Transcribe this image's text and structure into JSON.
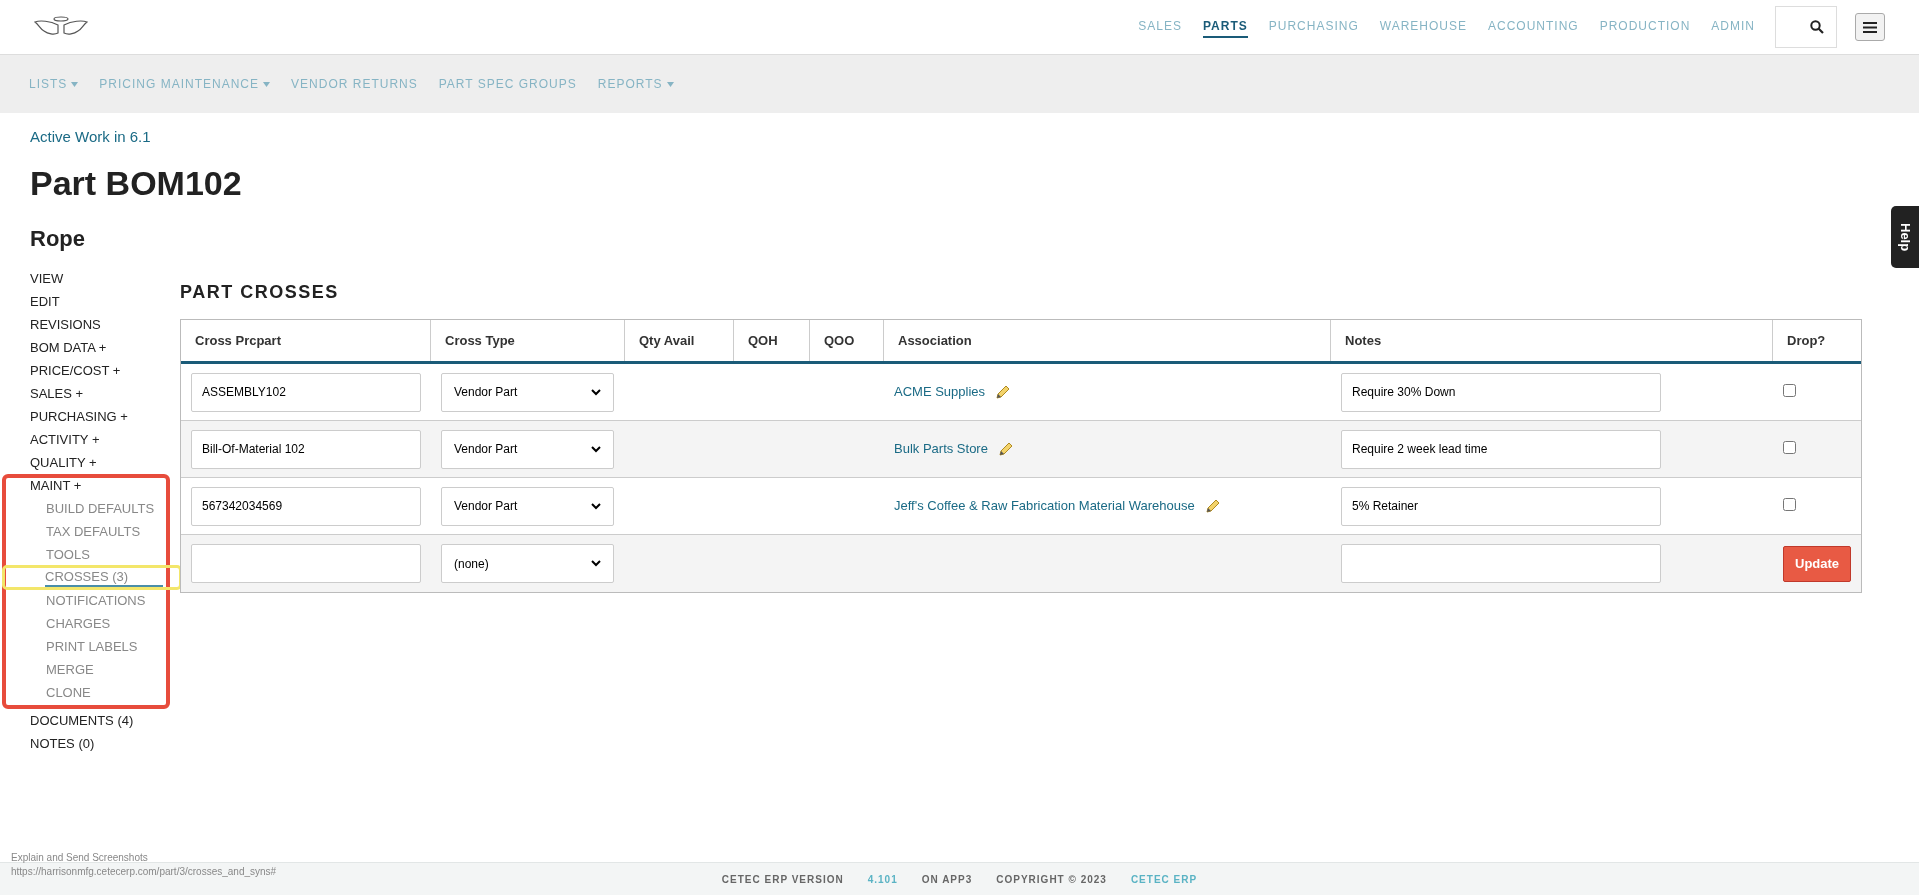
{
  "top_nav": [
    {
      "label": "SALES",
      "selected": false
    },
    {
      "label": "PARTS",
      "selected": true
    },
    {
      "label": "PURCHASING",
      "selected": false
    },
    {
      "label": "WAREHOUSE",
      "selected": false
    },
    {
      "label": "ACCOUNTING",
      "selected": false
    },
    {
      "label": "PRODUCTION",
      "selected": false
    },
    {
      "label": "ADMIN",
      "selected": false
    }
  ],
  "sub_nav": [
    {
      "label": "LISTS",
      "dropdown": true
    },
    {
      "label": "PRICING MAINTENANCE",
      "dropdown": true
    },
    {
      "label": "VENDOR RETURNS",
      "dropdown": false
    },
    {
      "label": "PART SPEC GROUPS",
      "dropdown": false
    },
    {
      "label": "REPORTS",
      "dropdown": true
    }
  ],
  "breadcrumb": "Active Work in 6.1",
  "title": "Part BOM102",
  "subtitle": "Rope",
  "sidebar": [
    {
      "label": "VIEW"
    },
    {
      "label": "EDIT"
    },
    {
      "label": "REVISIONS"
    },
    {
      "label": "BOM DATA +"
    },
    {
      "label": "PRICE/COST +"
    },
    {
      "label": "SALES +"
    },
    {
      "label": "PURCHASING +"
    },
    {
      "label": "ACTIVITY +"
    },
    {
      "label": "QUALITY +"
    },
    {
      "label": "MAINT +",
      "children": [
        {
          "label": "BUILD DEFAULTS",
          "selected": false
        },
        {
          "label": "TAX DEFAULTS",
          "selected": false
        },
        {
          "label": "TOOLS",
          "selected": false
        },
        {
          "label": "CROSSES (3)",
          "selected": true
        },
        {
          "label": "NOTIFICATIONS",
          "selected": false
        },
        {
          "label": "CHARGES",
          "selected": false
        },
        {
          "label": "PRINT LABELS",
          "selected": false
        },
        {
          "label": "MERGE",
          "selected": false
        },
        {
          "label": "CLONE",
          "selected": false
        }
      ]
    },
    {
      "label": "DOCUMENTS (4)"
    },
    {
      "label": "NOTES (0)"
    }
  ],
  "section_title": "PART CROSSES",
  "table": {
    "columns": [
      "Cross Prcpart",
      "Cross Type",
      "Qty Avail",
      "QOH",
      "QOO",
      "Association",
      "Notes",
      "Drop?"
    ],
    "rows": [
      {
        "cross_prcpart": "ASSEMBLY102",
        "cross_type": "Vendor Part",
        "association": "ACME Supplies",
        "notes": "Require 30% Down",
        "drop": false
      },
      {
        "cross_prcpart": "Bill-Of-Material 102",
        "cross_type": "Vendor Part",
        "association": "Bulk Parts Store",
        "notes": "Require 2 week lead time",
        "drop": false
      },
      {
        "cross_prcpart": "567342034569",
        "cross_type": "Vendor Part",
        "association": "Jeff's Coffee & Raw Fabrication Material Warehouse",
        "notes": "5% Retainer",
        "drop": false
      }
    ],
    "new_row": {
      "cross_type": "(none)",
      "button": "Update"
    }
  },
  "help_tab": "Help",
  "status_overlay": [
    "Explain and Send Screenshots",
    "https://harrisonmfg.cetecerp.com/part/3/crosses_and_syns#"
  ],
  "footer": [
    {
      "text": "CETEC ERP VERSION",
      "link": false
    },
    {
      "text": "4.101",
      "link": true
    },
    {
      "text": "ON APP3",
      "link": false
    },
    {
      "text": "COPYRIGHT © 2023",
      "link": false
    },
    {
      "text": "CETEC ERP",
      "link": true
    }
  ]
}
